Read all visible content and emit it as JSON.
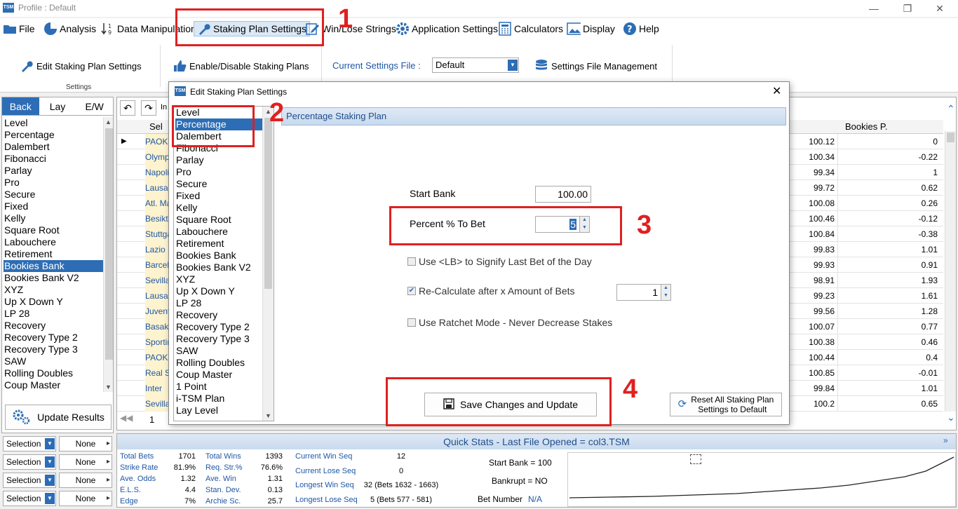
{
  "window": {
    "title": "Profile : Default",
    "logo": "TSM"
  },
  "menu": [
    {
      "label": "File",
      "icon": "folder-icon"
    },
    {
      "label": "Analysis",
      "icon": "pie-chart-icon"
    },
    {
      "label": "Data Manipulation",
      "icon": "sort-numeric-icon"
    },
    {
      "label": "Staking Plan Settings",
      "icon": "wrench-icon"
    },
    {
      "label": "Win/Lose Strings",
      "icon": "edit-icon"
    },
    {
      "label": "Application Settings",
      "icon": "gear-icon"
    },
    {
      "label": "Calculators",
      "icon": "calculator-icon"
    },
    {
      "label": "Display",
      "icon": "image-icon"
    },
    {
      "label": "Help",
      "icon": "help-icon"
    }
  ],
  "ribbon": {
    "edit_label": "Edit Staking Plan Settings",
    "settings_group": "Settings",
    "enable_label": "Enable/Disable Staking Plans",
    "current_file_label": "Current Settings File :",
    "current_file_value": "Default",
    "file_mgmt_label": "Settings File Management"
  },
  "left_tabs": [
    "Back",
    "Lay",
    "E/W"
  ],
  "plans": [
    "Level",
    "Percentage",
    "Dalembert",
    "Fibonacci",
    "Parlay",
    "Pro",
    "Secure",
    "Fixed",
    "Kelly",
    "Square Root",
    "Labouchere",
    "Retirement",
    "Bookies Bank",
    "Bookies Bank V2",
    "XYZ",
    "Up X Down Y",
    "LP 28",
    "Recovery",
    "Recovery Type 2",
    "Recovery Type 3",
    "SAW",
    "Rolling Doubles",
    "Coup Master"
  ],
  "left_selected": "Bookies Bank",
  "update_button": "Update Results",
  "selection_rows": [
    {
      "field": "Selection",
      "value": "None"
    },
    {
      "field": "Selection",
      "value": "None"
    },
    {
      "field": "Selection",
      "value": "None"
    },
    {
      "field": "Selection",
      "value": "None"
    }
  ],
  "grid": {
    "nav_label": "In",
    "col_sel": "Sel",
    "col_bookies": "Bookies P.",
    "page": "1",
    "rows": [
      {
        "name": "PAOK",
        "odds": "100.12",
        "bp": "0"
      },
      {
        "name": "Olympiacos",
        "odds": "100.34",
        "bp": "-0.22"
      },
      {
        "name": "Napoli",
        "odds": "99.34",
        "bp": "1"
      },
      {
        "name": "Lausanne",
        "odds": "99.72",
        "bp": "0.62"
      },
      {
        "name": "Atl. Madrid",
        "odds": "100.08",
        "bp": "0.26"
      },
      {
        "name": "Besiktas",
        "odds": "100.46",
        "bp": "-0.12"
      },
      {
        "name": "Stuttgart",
        "odds": "100.84",
        "bp": "-0.38"
      },
      {
        "name": "Lazio",
        "odds": "99.83",
        "bp": "1.01"
      },
      {
        "name": "Barcelona",
        "odds": "99.93",
        "bp": "0.91"
      },
      {
        "name": "Sevilla",
        "odds": "98.91",
        "bp": "1.93"
      },
      {
        "name": "Lausanne",
        "odds": "99.23",
        "bp": "1.61"
      },
      {
        "name": "Juventus",
        "odds": "99.56",
        "bp": "1.28"
      },
      {
        "name": "Basaksehir",
        "odds": "100.07",
        "bp": "0.77"
      },
      {
        "name": "Sporting",
        "odds": "100.38",
        "bp": "0.46"
      },
      {
        "name": "PAOK",
        "odds": "100.44",
        "bp": "0.4"
      },
      {
        "name": "Real Sociedad",
        "odds": "100.85",
        "bp": "-0.01"
      },
      {
        "name": "Inter",
        "odds": "99.84",
        "bp": "1.01"
      },
      {
        "name": "Sevilla",
        "odds": "100.2",
        "bp": "0.65"
      }
    ]
  },
  "modal": {
    "title": "Edit Staking Plan Settings",
    "logo": "TSM",
    "header": "Percentage Staking Plan",
    "plans": [
      "Level",
      "Percentage",
      "Dalembert",
      "Fibonacci",
      "Parlay",
      "Pro",
      "Secure",
      "Fixed",
      "Kelly",
      "Square Root",
      "Labouchere",
      "Retirement",
      "Bookies Bank",
      "Bookies Bank V2",
      "XYZ",
      "Up X Down Y",
      "LP 28",
      "Recovery",
      "Recovery Type 2",
      "Recovery Type 3",
      "SAW",
      "Rolling Doubles",
      "Coup Master",
      "1 Point",
      "i-TSM Plan",
      "Lay Level"
    ],
    "selected": "Percentage",
    "start_bank_label": "Start Bank",
    "start_bank_value": "100.00",
    "percent_label": "Percent % To Bet",
    "percent_value": "5",
    "chk_lb": "Use <LB> to Signify Last Bet of the Day",
    "chk_lb_checked": false,
    "chk_recalc": "Re-Calculate after x Amount of Bets",
    "chk_recalc_checked": true,
    "recalc_value": "1",
    "chk_ratchet": "Use Ratchet Mode - Never Decrease Stakes",
    "chk_ratchet_checked": false,
    "save_button": "Save Changes and Update",
    "reset_button_line1": "Reset All Staking Plan",
    "reset_button_line2": "Settings to Default"
  },
  "annotations": [
    "1",
    "2",
    "3",
    "4"
  ],
  "quickstats": {
    "header": "Quick Stats - Last File Opened = col3.TSM",
    "c1": [
      {
        "k": "Total Bets",
        "v": "1701"
      },
      {
        "k": "Strike Rate",
        "v": "81.9%"
      },
      {
        "k": "Ave. Odds",
        "v": "1.32"
      },
      {
        "k": "E.L.S.",
        "v": "4.4"
      },
      {
        "k": "Edge",
        "v": "7%"
      }
    ],
    "c2": [
      {
        "k": "Total Wins",
        "v": "1393"
      },
      {
        "k": "Req. Str.%",
        "v": "76.6%"
      },
      {
        "k": "Ave. Win",
        "v": "1.31"
      },
      {
        "k": "Stan. Dev.",
        "v": "0.13"
      },
      {
        "k": "Archie Sc.",
        "v": "25.7"
      }
    ],
    "c3": [
      {
        "k": "Current Win Seq",
        "v": "12"
      },
      {
        "k": "Current Lose Seq",
        "v": "0"
      },
      {
        "k": "Longest Win Seq",
        "v": "32  (Bets 1632 - 1663)"
      },
      {
        "k": "Longest Lose Seq",
        "v": "5  (Bets 577 - 581)"
      }
    ],
    "start_bank": "Start Bank = 100",
    "bankrupt": "Bankrupt = NO",
    "bet_number_label": "Bet Number",
    "bet_number_value": "N/A"
  },
  "colors": {
    "accent": "#2d6db5",
    "annotation": "#e02020"
  }
}
